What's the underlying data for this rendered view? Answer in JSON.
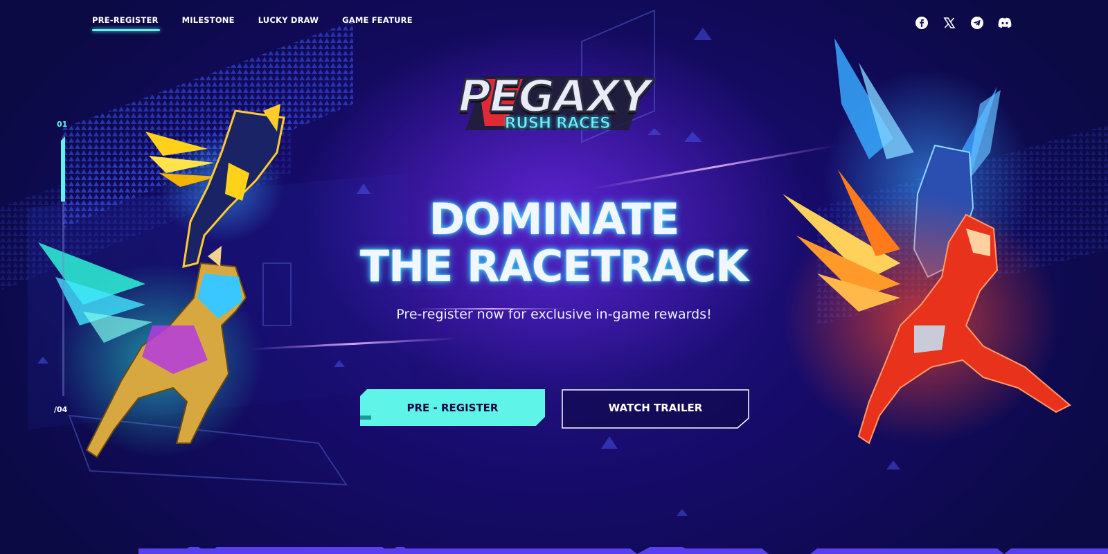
{
  "nav": {
    "items": [
      {
        "label": "PRE-REGISTER",
        "active": true
      },
      {
        "label": "MILESTONE",
        "active": false
      },
      {
        "label": "LUCKY DRAW",
        "active": false
      },
      {
        "label": "GAME FEATURE",
        "active": false
      }
    ]
  },
  "socials": [
    "facebook-icon",
    "x-icon",
    "telegram-icon",
    "discord-icon"
  ],
  "logo": {
    "title": "PEGAXY",
    "subtitle": "RUSH RACES"
  },
  "hero": {
    "headline_line1": "DOMINATE",
    "headline_line2": "THE RACETRACK",
    "subtitle": "Pre-register now for exclusive in-game rewards!",
    "primary_button": "PRE - REGISTER",
    "secondary_button": "WATCH TRAILER"
  },
  "slider": {
    "current": "01",
    "total": "/04",
    "progress_fraction": 0.25
  },
  "colors": {
    "accent": "#5ff4e8",
    "background_dark": "#0b0a44",
    "background_purple": "#2a148f",
    "bottom_bar": "#5a3ff0"
  }
}
